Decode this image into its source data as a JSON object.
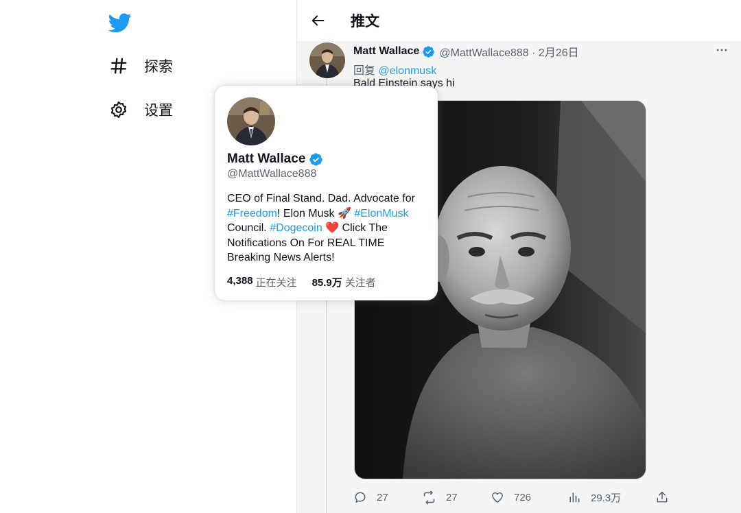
{
  "colors": {
    "brand": "#1d9bf0",
    "text_primary": "#0f1419",
    "text_secondary": "#536471",
    "like_heart": "#f91880"
  },
  "nav": {
    "logo_icon": "twitter-bird-icon",
    "items": [
      {
        "label": "探索",
        "icon": "hashtag-icon"
      },
      {
        "label": "设置",
        "icon": "gear-icon"
      }
    ]
  },
  "header": {
    "back_icon": "arrow-left-icon",
    "title": "推文"
  },
  "tweet": {
    "author_name": "Matt Wallace",
    "handle_date": "@MattWallace888 · 2月26日",
    "reply_prefix": "回复",
    "reply_to": "@elonmusk",
    "text": "Bald Einstein says hi",
    "actions": {
      "replies": "27",
      "retweets": "27",
      "likes": "726",
      "views": "29.3万"
    }
  },
  "hover_card": {
    "name": "Matt Wallace",
    "handle": "@MattWallace888",
    "bio": {
      "part1": "CEO of Final Stand. Dad. Advocate for ",
      "tag1": "#Freedom",
      "part2": "! Elon Musk 🚀 ",
      "tag2": "#ElonMusk",
      "part3": " Council. ",
      "tag3": "#Dogecoin",
      "part4": " ❤️ Click The Notifications On For REAL TIME Breaking News Alerts!"
    },
    "following_count": "4,388",
    "following_label": "正在关注",
    "followers_count": "85.9万",
    "followers_label": "关注者"
  }
}
